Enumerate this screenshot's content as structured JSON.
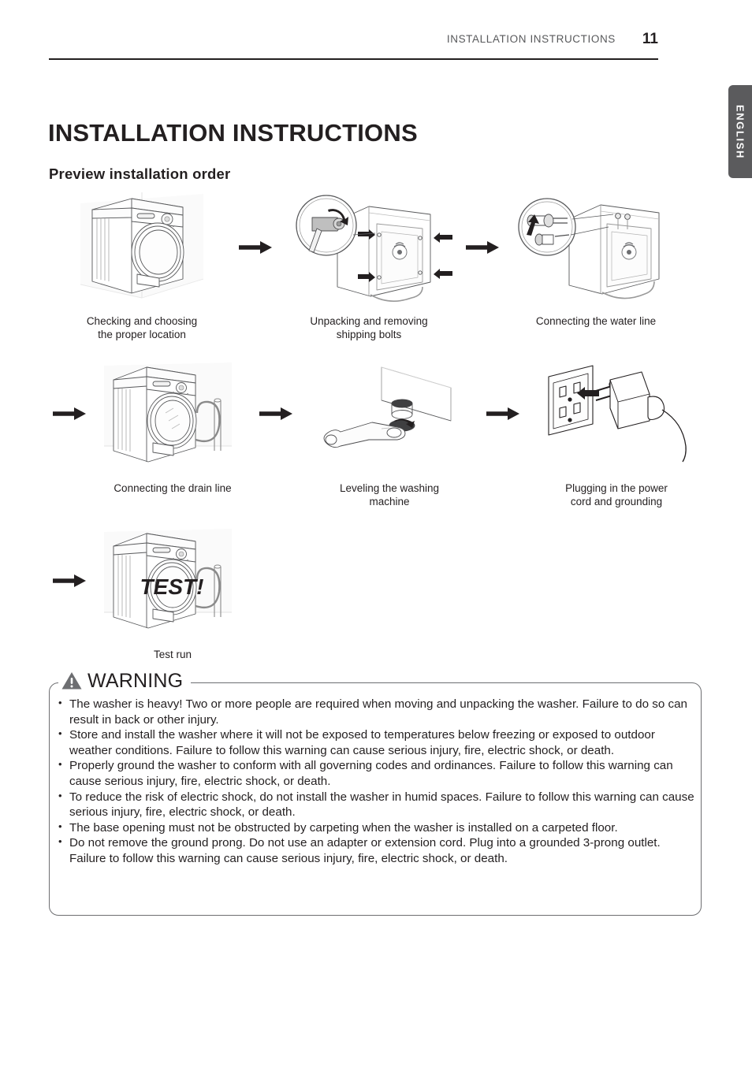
{
  "header": {
    "title": "INSTALLATION INSTRUCTIONS",
    "page_number": "11"
  },
  "language_tab": {
    "label": "ENGLISH"
  },
  "chapter_title": "INSTALLATION INSTRUCTIONS",
  "section_title": "Preview installation order",
  "preview_flow": {
    "steps": [
      {
        "caption": "Checking and choosing\nthe proper location",
        "art": "washer-front-corner"
      },
      {
        "caption": "Unpacking and removing\nshipping bolts",
        "art": "washer-rear-bolts-wrench"
      },
      {
        "caption": "Connecting the water line",
        "art": "washer-rear-water-inlets"
      },
      {
        "caption": "Connecting the drain line",
        "art": "washer-drain-hose"
      },
      {
        "caption": "Leveling the washing\nmachine",
        "art": "leveling-foot-wrench"
      },
      {
        "caption": "Plugging in the power\ncord and grounding",
        "art": "outlet-plug"
      },
      {
        "caption": "Test run",
        "art": "washer-test-run"
      }
    ],
    "arrow_icon": "arrow-right-icon",
    "test_label": "TEST!"
  },
  "warning": {
    "title": "WARNING",
    "icon": "warning-triangle-icon",
    "items": [
      "The washer is heavy! Two or more people are required when moving and unpacking the washer. Failure to do so can result in back or other injury.",
      "Store and install the washer where it will not be exposed to temperatures below freezing or exposed to outdoor weather conditions. Failure to follow this warning can cause serious injury, fire, electric shock, or death.",
      "Properly ground the washer to conform with all governing codes and ordinances. Failure to follow this warning can cause serious injury, fire, electric shock, or death.",
      "To reduce the risk of electric shock, do not install the washer in humid spaces. Failure to follow this warning can cause serious injury, fire, electric shock, or death.",
      "The base opening must not be obstructed by carpeting when the washer is installed on a carpeted floor.",
      "Do not remove the ground prong. Do not use an adapter or extension cord. Plug into a grounded 3-prong outlet. Failure to follow this warning can cause serious injury, fire, electric shock, or death."
    ]
  },
  "colors": {
    "text": "#231f20",
    "header_text": "#58595b",
    "tab_background": "#5b5b5d",
    "warning_border": "#6d6e71",
    "line_art": "#4d4d4f"
  }
}
